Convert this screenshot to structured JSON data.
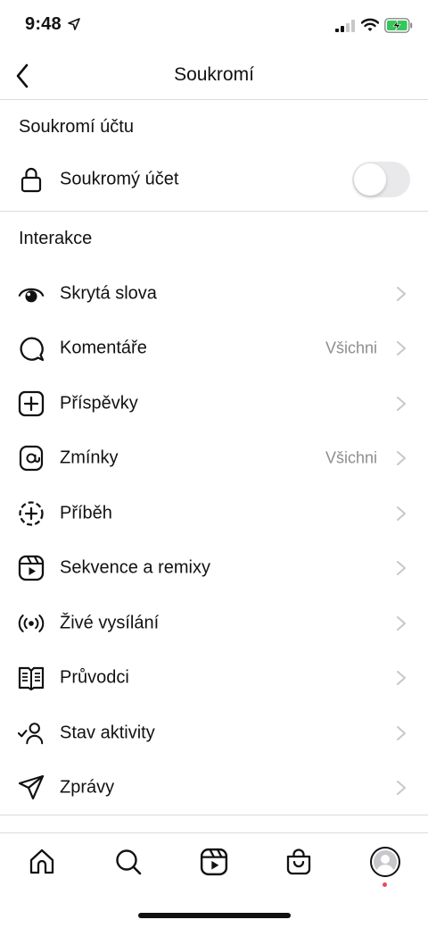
{
  "status_bar": {
    "time": "9:48",
    "icons": [
      "location-arrow-icon",
      "signal-icon",
      "wifi-icon",
      "battery-charging-icon"
    ],
    "battery_color": "#34c759"
  },
  "header": {
    "title": "Soukromí",
    "back_icon": "chevron-left-icon"
  },
  "account_section": {
    "title": "Soukromí účtu",
    "private_account": {
      "label": "Soukromý účet",
      "icon": "lock-icon",
      "enabled": false
    }
  },
  "interactions_section": {
    "title": "Interakce",
    "items": [
      {
        "label": "Skrytá slova",
        "value": "",
        "icon": "eye-icon"
      },
      {
        "label": "Komentáře",
        "value": "Všichni",
        "icon": "comment-icon"
      },
      {
        "label": "Příspěvky",
        "value": "",
        "icon": "post-add-icon"
      },
      {
        "label": "Zmínky",
        "value": "Všichni",
        "icon": "at-sign-icon"
      },
      {
        "label": "Příběh",
        "value": "",
        "icon": "story-add-icon"
      },
      {
        "label": "Sekvence a remixy",
        "value": "",
        "icon": "reels-icon"
      },
      {
        "label": "Živé vysílání",
        "value": "",
        "icon": "live-broadcast-icon"
      },
      {
        "label": "Průvodci",
        "value": "",
        "icon": "guide-icon"
      },
      {
        "label": "Stav aktivity",
        "value": "",
        "icon": "activity-status-icon"
      },
      {
        "label": "Zprávy",
        "value": "",
        "icon": "paper-plane-icon"
      }
    ]
  },
  "tab_bar": {
    "tabs": [
      "home-icon",
      "search-icon",
      "reels-icon",
      "shop-icon",
      "profile-avatar"
    ],
    "notification_dot_color": "#ed4956"
  }
}
